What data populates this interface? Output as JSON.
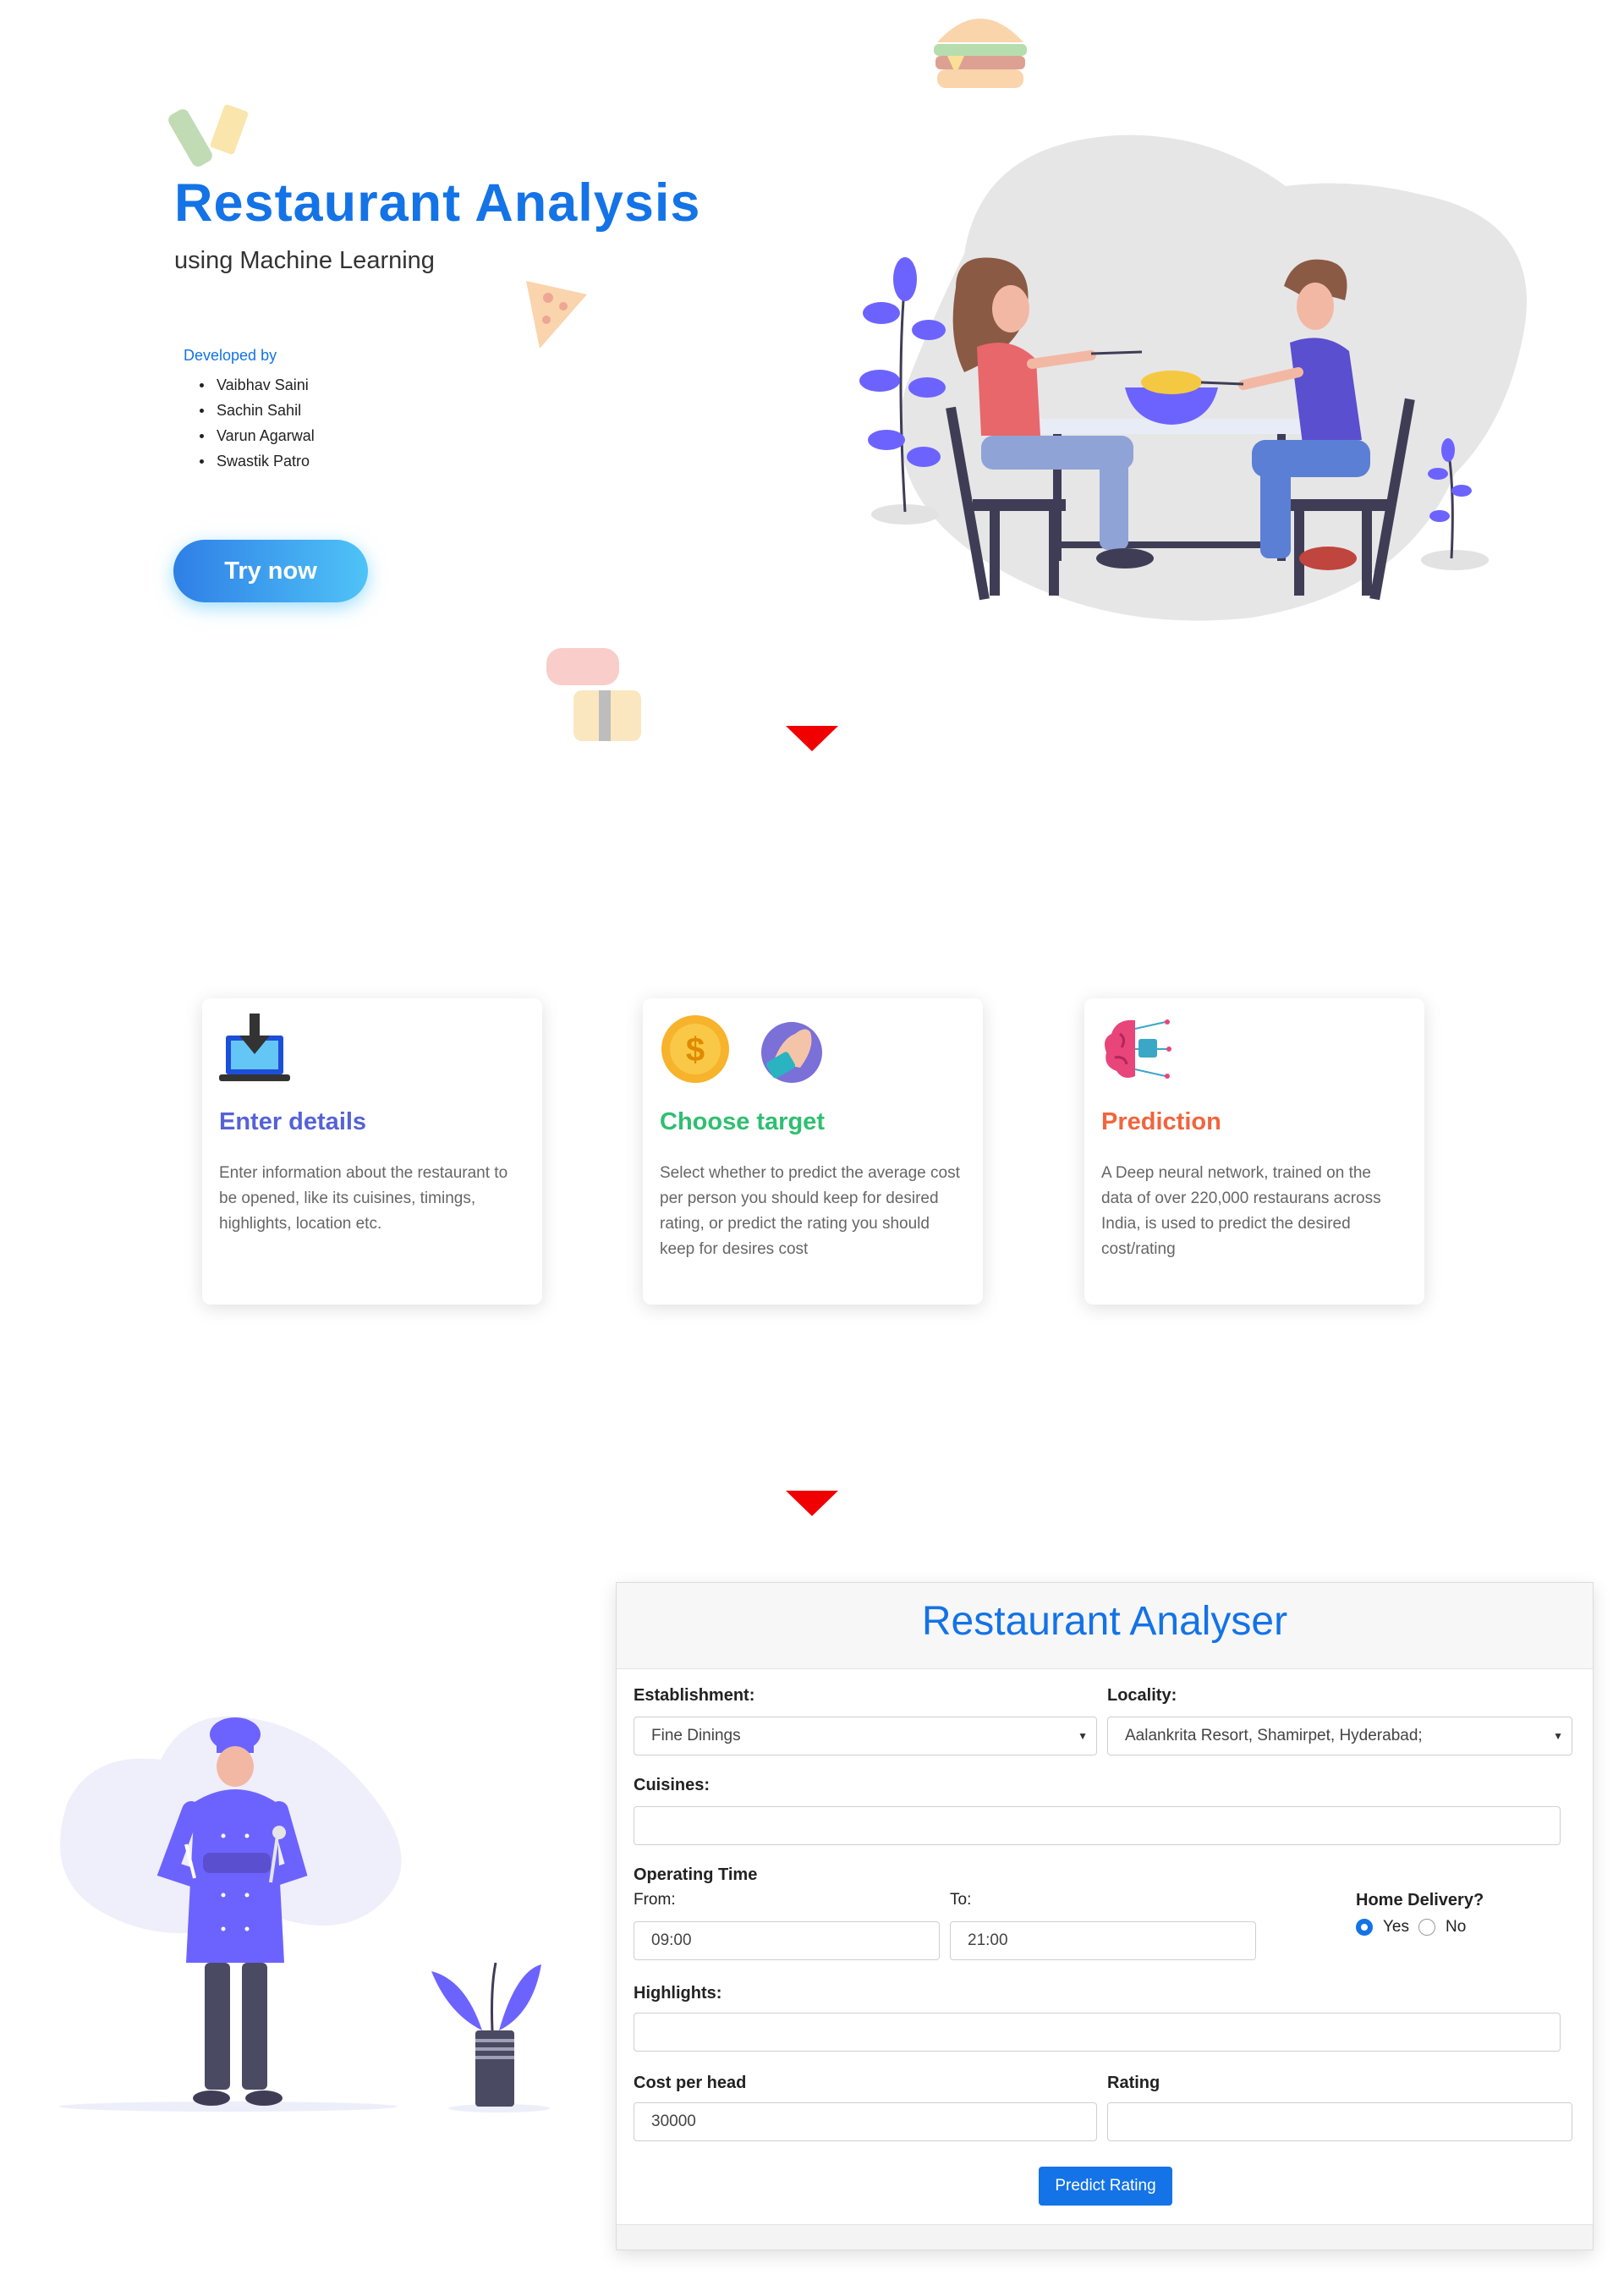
{
  "hero": {
    "title": "Restaurant Analysis",
    "subtitle": "using Machine Learning",
    "developed_by_label": "Developed by",
    "developers": [
      "Vaibhav Saini",
      "Sachin Sahil",
      "Varun Agarwal",
      "Swastik Patro"
    ],
    "cta_label": "Try now"
  },
  "steps": [
    {
      "title": "Enter details",
      "color": "#5662d6",
      "description": "Enter information about the restaurant to be opened, like its cuisines, timings, highlights, location etc."
    },
    {
      "title": "Choose target",
      "color": "#2fbf71",
      "description": "Select whether to predict the average cost per person you should keep for desired rating, or predict the rating you should keep for desires cost"
    },
    {
      "title": "Prediction",
      "color": "#f2643c",
      "description": "A Deep neural network, trained on the data of over 220,000 restaurans across India, is used to predict the desired cost/rating"
    }
  ],
  "form": {
    "title": "Restaurant Analyser",
    "establishment_label": "Establishment:",
    "establishment_value": "Fine Dinings",
    "locality_label": "Locality:",
    "locality_value": "Aalankrita Resort, Shamirpet, Hyderabad;",
    "cuisines_label": "Cuisines:",
    "cuisines_value": "",
    "operating_time_label": "Operating Time",
    "from_label": "From:",
    "from_value": "09:00",
    "to_label": "To:",
    "to_value": "21:00",
    "home_delivery_label": "Home Delivery?",
    "home_delivery_options": [
      "Yes",
      "No"
    ],
    "home_delivery_selected": "Yes",
    "highlights_label": "Highlights:",
    "highlights_value": "",
    "cost_label": "Cost per head",
    "cost_value": "30000",
    "rating_label": "Rating",
    "rating_value": "",
    "submit_label": "Predict Rating"
  },
  "colors": {
    "accent": "#1473e6",
    "arrow": "#f00000",
    "illustration_purple": "#6c63ff"
  }
}
